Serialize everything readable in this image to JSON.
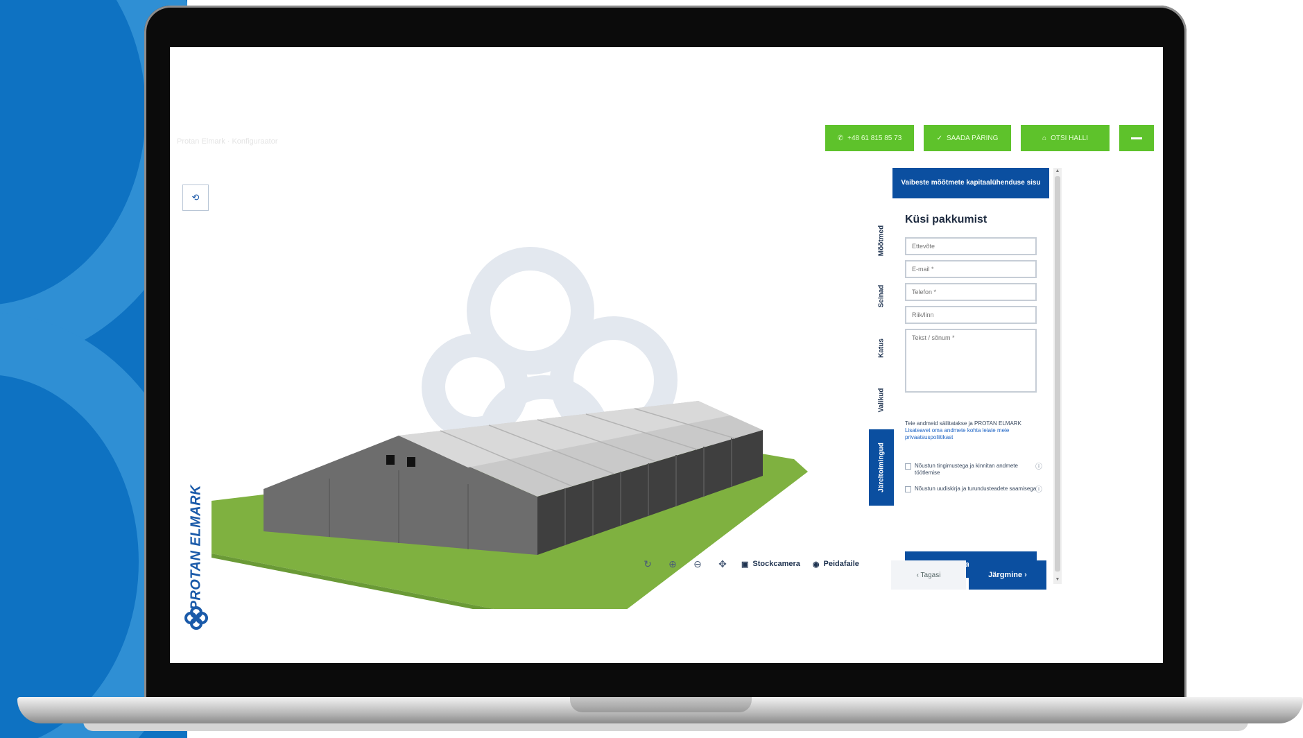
{
  "header": {
    "breadcrumb": "Protan Elmark · Konfiguraator",
    "phone": {
      "icon": "phone-icon",
      "label": "+48 61 815 85 73"
    },
    "offer": {
      "icon": "check-icon",
      "label": "SAADA PÄRING"
    },
    "search": {
      "icon": "hall-icon",
      "label": "OTSI HALLI"
    },
    "menu_icon": "hamburger-menu-icon"
  },
  "colors": {
    "accent_green": "#5ec22b",
    "brand_blue": "#0b4fa0",
    "ground_green": "#7fb140",
    "background_blue": "#0e72c2"
  },
  "viewer": {
    "reset_icon": "reset-view-icon"
  },
  "brand": {
    "name": "PROTAN ELMARK",
    "logo_icon": "protan-logo-icon"
  },
  "toolbar": {
    "rotate_icon": "rotate-icon",
    "zoom_in_icon": "zoom-in-icon",
    "zoom_out_icon": "zoom-out-icon",
    "pan_icon": "pan-icon",
    "screenshot_label": "Stockcamera",
    "view_label": "Peidafaile"
  },
  "panel": {
    "header": "Vaibeste mõõtmete kapitaalühenduse sisu",
    "tabs": [
      "Mõõtmed",
      "Seinad",
      "Katus",
      "Valikud",
      "Järeltoimingud"
    ],
    "active_tab_index": 4,
    "form_title": "Küsi pakkumist",
    "fields": [
      {
        "placeholder": "Ettevõte"
      },
      {
        "placeholder": "E-mail *"
      },
      {
        "placeholder": "Telefon *"
      },
      {
        "placeholder": "Riik/linn"
      }
    ],
    "message_placeholder": "Tekst / sõnum *",
    "notice_text": "Teie andmeid säilitatakse ja PROTAN ELMARK",
    "notice_link": "Lisateavet oma andmete kohta leiate meie privaatsuspoliitikast",
    "checks": [
      {
        "label": "Nõustun tingimustega ja kinnitan andmete töötlemise"
      },
      {
        "label": "Nõustun uudiskirja ja turundusteadete saamisega"
      }
    ],
    "submit": "Saada päring",
    "back": "‹ Tagasi",
    "next": "Järgmine ›"
  }
}
